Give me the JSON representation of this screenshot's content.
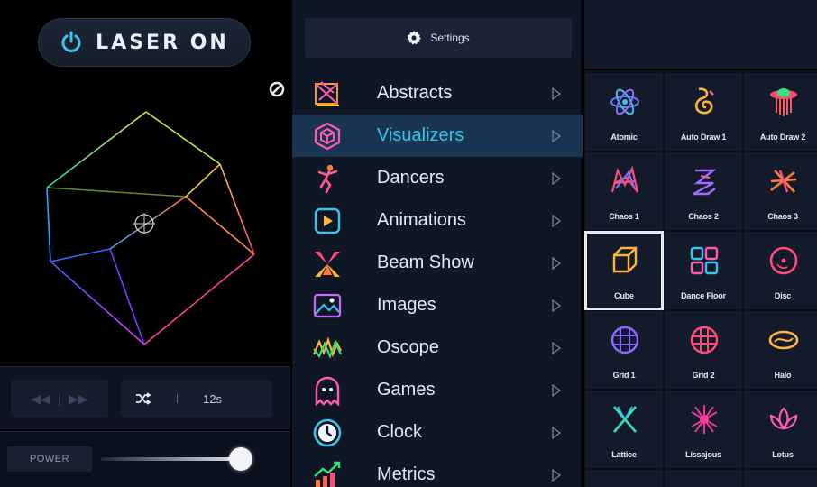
{
  "laser": {
    "label": "LASER ON",
    "icon": "power-icon"
  },
  "preview": {
    "cancel_icon": "cancel-icon"
  },
  "transport": {
    "prev_icon": "rewind-icon",
    "next_icon": "fast-forward-icon",
    "shuffle_icon": "shuffle-icon",
    "time": "12s"
  },
  "power": {
    "label": "POWER",
    "level": 0.95
  },
  "settings": {
    "label": "Settings",
    "icon": "gear-icon"
  },
  "menu": {
    "items": [
      {
        "label": "Abstracts",
        "icon": "abstracts-icon"
      },
      {
        "label": "Visualizers",
        "icon": "visualizers-icon",
        "active": true
      },
      {
        "label": "Dancers",
        "icon": "dancers-icon"
      },
      {
        "label": "Animations",
        "icon": "animations-icon"
      },
      {
        "label": "Beam Show",
        "icon": "beam-show-icon"
      },
      {
        "label": "Images",
        "icon": "images-icon"
      },
      {
        "label": "Oscope",
        "icon": "oscope-icon"
      },
      {
        "label": "Games",
        "icon": "games-icon"
      },
      {
        "label": "Clock",
        "icon": "clock-icon"
      },
      {
        "label": "Metrics",
        "icon": "metrics-icon"
      }
    ]
  },
  "tiles": [
    {
      "label": "Atomic",
      "icon": "atomic-icon"
    },
    {
      "label": "Auto Draw 1",
      "icon": "auto-draw-1-icon"
    },
    {
      "label": "Auto Draw 2",
      "icon": "auto-draw-2-icon"
    },
    {
      "label": "Chaos 1",
      "icon": "chaos-1-icon"
    },
    {
      "label": "Chaos 2",
      "icon": "chaos-2-icon"
    },
    {
      "label": "Chaos 3",
      "icon": "chaos-3-icon"
    },
    {
      "label": "Cube",
      "icon": "cube-icon",
      "selected": true
    },
    {
      "label": "Dance Floor",
      "icon": "dance-floor-icon"
    },
    {
      "label": "Disc",
      "icon": "disc-icon"
    },
    {
      "label": "Grid 1",
      "icon": "grid-1-icon"
    },
    {
      "label": "Grid 2",
      "icon": "grid-2-icon"
    },
    {
      "label": "Halo",
      "icon": "halo-icon"
    },
    {
      "label": "Lattice",
      "icon": "lattice-icon"
    },
    {
      "label": "Lissajous",
      "icon": "lissajous-icon"
    },
    {
      "label": "Lotus",
      "icon": "lotus-icon"
    }
  ],
  "colors": {
    "accent": "#3dc2ea",
    "active_row": "#1a3552",
    "panel": "#0f1624"
  }
}
